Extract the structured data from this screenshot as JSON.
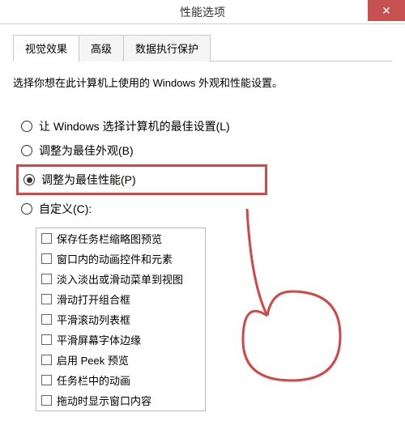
{
  "window": {
    "title": "性能选项"
  },
  "tabs": [
    {
      "label": "视觉效果",
      "active": true
    },
    {
      "label": "高级",
      "active": false
    },
    {
      "label": "数据执行保护",
      "active": false
    }
  ],
  "instruction": "选择你想在此计算机上使用的 Windows 外观和性能设置。",
  "radios": [
    {
      "label": "让 Windows 选择计算机的最佳设置(L)",
      "selected": false,
      "highlighted": false
    },
    {
      "label": "调整为最佳外观(B)",
      "selected": false,
      "highlighted": false
    },
    {
      "label": "调整为最佳性能(P)",
      "selected": true,
      "highlighted": true
    },
    {
      "label": "自定义(C):",
      "selected": false,
      "highlighted": false
    }
  ],
  "checkboxes": [
    {
      "label": "保存任务栏缩略图预览",
      "checked": false
    },
    {
      "label": "窗口内的动画控件和元素",
      "checked": false
    },
    {
      "label": "淡入淡出或滑动菜单到视图",
      "checked": false
    },
    {
      "label": "滑动打开组合框",
      "checked": false
    },
    {
      "label": "平滑滚动列表框",
      "checked": false
    },
    {
      "label": "平滑屏幕字体边缘",
      "checked": false
    },
    {
      "label": "启用 Peek 预览",
      "checked": false
    },
    {
      "label": "任务栏中的动画",
      "checked": false
    },
    {
      "label": "拖动时显示窗口内容",
      "checked": false
    }
  ],
  "colors": {
    "close_bg": "#c75050",
    "highlight_border": "#d04848"
  }
}
